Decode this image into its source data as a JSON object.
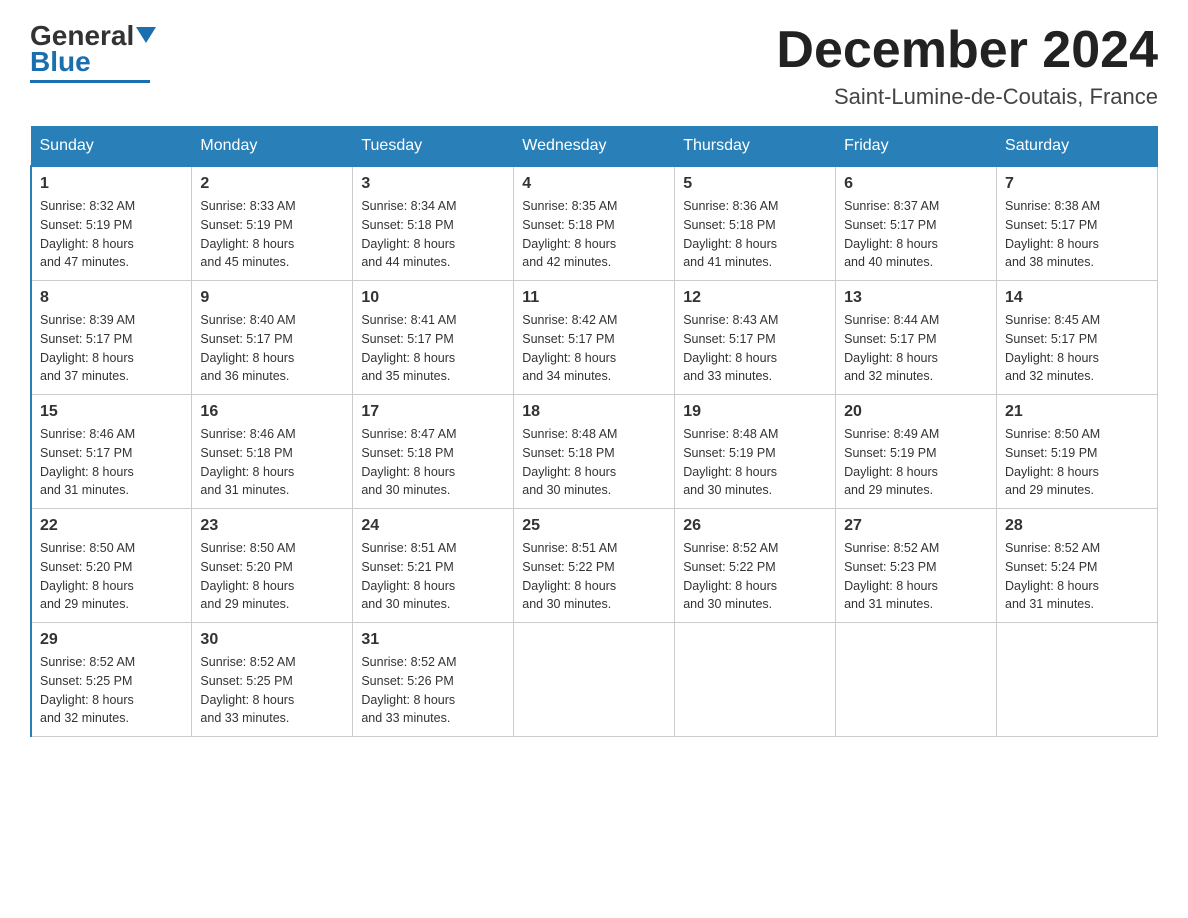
{
  "logo": {
    "general": "General",
    "blue": "Blue"
  },
  "title": "December 2024",
  "subtitle": "Saint-Lumine-de-Coutais, France",
  "days_of_week": [
    "Sunday",
    "Monday",
    "Tuesday",
    "Wednesday",
    "Thursday",
    "Friday",
    "Saturday"
  ],
  "weeks": [
    [
      {
        "day": "1",
        "sunrise": "8:32 AM",
        "sunset": "5:19 PM",
        "daylight": "8 hours and 47 minutes."
      },
      {
        "day": "2",
        "sunrise": "8:33 AM",
        "sunset": "5:19 PM",
        "daylight": "8 hours and 45 minutes."
      },
      {
        "day": "3",
        "sunrise": "8:34 AM",
        "sunset": "5:18 PM",
        "daylight": "8 hours and 44 minutes."
      },
      {
        "day": "4",
        "sunrise": "8:35 AM",
        "sunset": "5:18 PM",
        "daylight": "8 hours and 42 minutes."
      },
      {
        "day": "5",
        "sunrise": "8:36 AM",
        "sunset": "5:18 PM",
        "daylight": "8 hours and 41 minutes."
      },
      {
        "day": "6",
        "sunrise": "8:37 AM",
        "sunset": "5:17 PM",
        "daylight": "8 hours and 40 minutes."
      },
      {
        "day": "7",
        "sunrise": "8:38 AM",
        "sunset": "5:17 PM",
        "daylight": "8 hours and 38 minutes."
      }
    ],
    [
      {
        "day": "8",
        "sunrise": "8:39 AM",
        "sunset": "5:17 PM",
        "daylight": "8 hours and 37 minutes."
      },
      {
        "day": "9",
        "sunrise": "8:40 AM",
        "sunset": "5:17 PM",
        "daylight": "8 hours and 36 minutes."
      },
      {
        "day": "10",
        "sunrise": "8:41 AM",
        "sunset": "5:17 PM",
        "daylight": "8 hours and 35 minutes."
      },
      {
        "day": "11",
        "sunrise": "8:42 AM",
        "sunset": "5:17 PM",
        "daylight": "8 hours and 34 minutes."
      },
      {
        "day": "12",
        "sunrise": "8:43 AM",
        "sunset": "5:17 PM",
        "daylight": "8 hours and 33 minutes."
      },
      {
        "day": "13",
        "sunrise": "8:44 AM",
        "sunset": "5:17 PM",
        "daylight": "8 hours and 32 minutes."
      },
      {
        "day": "14",
        "sunrise": "8:45 AM",
        "sunset": "5:17 PM",
        "daylight": "8 hours and 32 minutes."
      }
    ],
    [
      {
        "day": "15",
        "sunrise": "8:46 AM",
        "sunset": "5:17 PM",
        "daylight": "8 hours and 31 minutes."
      },
      {
        "day": "16",
        "sunrise": "8:46 AM",
        "sunset": "5:18 PM",
        "daylight": "8 hours and 31 minutes."
      },
      {
        "day": "17",
        "sunrise": "8:47 AM",
        "sunset": "5:18 PM",
        "daylight": "8 hours and 30 minutes."
      },
      {
        "day": "18",
        "sunrise": "8:48 AM",
        "sunset": "5:18 PM",
        "daylight": "8 hours and 30 minutes."
      },
      {
        "day": "19",
        "sunrise": "8:48 AM",
        "sunset": "5:19 PM",
        "daylight": "8 hours and 30 minutes."
      },
      {
        "day": "20",
        "sunrise": "8:49 AM",
        "sunset": "5:19 PM",
        "daylight": "8 hours and 29 minutes."
      },
      {
        "day": "21",
        "sunrise": "8:50 AM",
        "sunset": "5:19 PM",
        "daylight": "8 hours and 29 minutes."
      }
    ],
    [
      {
        "day": "22",
        "sunrise": "8:50 AM",
        "sunset": "5:20 PM",
        "daylight": "8 hours and 29 minutes."
      },
      {
        "day": "23",
        "sunrise": "8:50 AM",
        "sunset": "5:20 PM",
        "daylight": "8 hours and 29 minutes."
      },
      {
        "day": "24",
        "sunrise": "8:51 AM",
        "sunset": "5:21 PM",
        "daylight": "8 hours and 30 minutes."
      },
      {
        "day": "25",
        "sunrise": "8:51 AM",
        "sunset": "5:22 PM",
        "daylight": "8 hours and 30 minutes."
      },
      {
        "day": "26",
        "sunrise": "8:52 AM",
        "sunset": "5:22 PM",
        "daylight": "8 hours and 30 minutes."
      },
      {
        "day": "27",
        "sunrise": "8:52 AM",
        "sunset": "5:23 PM",
        "daylight": "8 hours and 31 minutes."
      },
      {
        "day": "28",
        "sunrise": "8:52 AM",
        "sunset": "5:24 PM",
        "daylight": "8 hours and 31 minutes."
      }
    ],
    [
      {
        "day": "29",
        "sunrise": "8:52 AM",
        "sunset": "5:25 PM",
        "daylight": "8 hours and 32 minutes."
      },
      {
        "day": "30",
        "sunrise": "8:52 AM",
        "sunset": "5:25 PM",
        "daylight": "8 hours and 33 minutes."
      },
      {
        "day": "31",
        "sunrise": "8:52 AM",
        "sunset": "5:26 PM",
        "daylight": "8 hours and 33 minutes."
      },
      null,
      null,
      null,
      null
    ]
  ]
}
